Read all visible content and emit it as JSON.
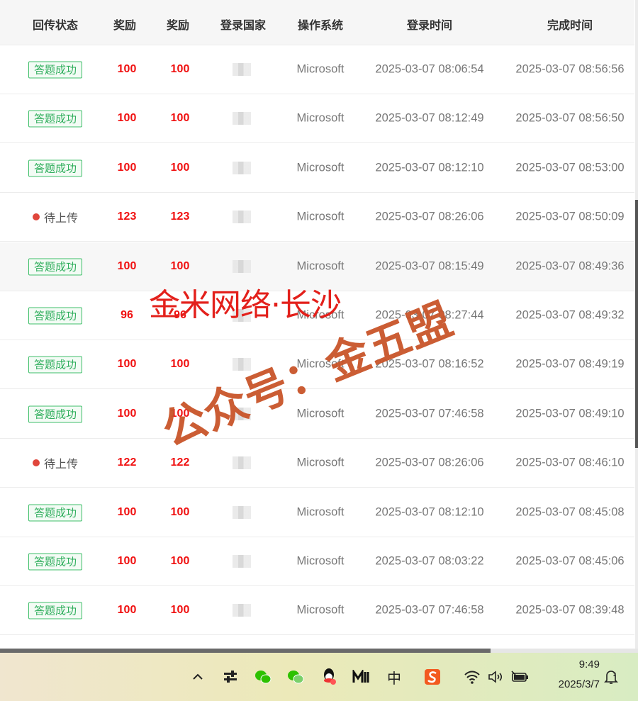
{
  "headers": [
    "回传状态",
    "奖励",
    "奖励",
    "登录国家",
    "操作系统",
    "登录时间",
    "完成时间"
  ],
  "rows": [
    {
      "status": "答题成功",
      "type": "success",
      "r1": "100",
      "r2": "100",
      "os": "Microsoft",
      "login": "2025-03-07 08:06:54",
      "done": "2025-03-07 08:56:56"
    },
    {
      "status": "答题成功",
      "type": "success",
      "r1": "100",
      "r2": "100",
      "os": "Microsoft",
      "login": "2025-03-07 08:12:49",
      "done": "2025-03-07 08:56:50"
    },
    {
      "status": "答题成功",
      "type": "success",
      "r1": "100",
      "r2": "100",
      "os": "Microsoft",
      "login": "2025-03-07 08:12:10",
      "done": "2025-03-07 08:53:00"
    },
    {
      "status": "待上传",
      "type": "pending",
      "r1": "123",
      "r2": "123",
      "os": "Microsoft",
      "login": "2025-03-07 08:26:06",
      "done": "2025-03-07 08:50:09"
    },
    {
      "status": "答题成功",
      "type": "success",
      "r1": "100",
      "r2": "100",
      "os": "Microsoft",
      "login": "2025-03-07 08:15:49",
      "done": "2025-03-07 08:49:36"
    },
    {
      "status": "答题成功",
      "type": "success",
      "r1": "96",
      "r2": "96",
      "os": "Microsoft",
      "login": "2025-03-07 08:27:44",
      "done": "2025-03-07 08:49:32"
    },
    {
      "status": "答题成功",
      "type": "success",
      "r1": "100",
      "r2": "100",
      "os": "Microsoft",
      "login": "2025-03-07 08:16:52",
      "done": "2025-03-07 08:49:19"
    },
    {
      "status": "答题成功",
      "type": "success",
      "r1": "100",
      "r2": "100",
      "os": "Microsoft",
      "login": "2025-03-07 07:46:58",
      "done": "2025-03-07 08:49:10"
    },
    {
      "status": "待上传",
      "type": "pending",
      "r1": "122",
      "r2": "122",
      "os": "Microsoft",
      "login": "2025-03-07 08:26:06",
      "done": "2025-03-07 08:46:10"
    },
    {
      "status": "答题成功",
      "type": "success",
      "r1": "100",
      "r2": "100",
      "os": "Microsoft",
      "login": "2025-03-07 08:12:10",
      "done": "2025-03-07 08:45:08"
    },
    {
      "status": "答题成功",
      "type": "success",
      "r1": "100",
      "r2": "100",
      "os": "Microsoft",
      "login": "2025-03-07 08:03:22",
      "done": "2025-03-07 08:45:06"
    },
    {
      "status": "答题成功",
      "type": "success",
      "r1": "100",
      "r2": "100",
      "os": "Microsoft",
      "login": "2025-03-07 07:46:58",
      "done": "2025-03-07 08:39:48"
    }
  ],
  "watermarks": {
    "line1": "金米网络·长沙",
    "line2": "公众号：金五盟"
  },
  "taskbar": {
    "icons": [
      "chevron-up-icon",
      "sliders-icon",
      "wechat-icon",
      "wechat-work-icon",
      "qq-icon",
      "m-app-icon",
      "ime-icon",
      "sogou-icon",
      "wifi-icon",
      "volume-icon",
      "battery-icon",
      "notification-icon"
    ],
    "ime_label": "中",
    "time": "9:49",
    "date": "2025/3/7"
  },
  "colors": {
    "success": "#2fae5c",
    "reward": "#f01010",
    "pending_dot": "#e0463c",
    "watermark_red": "#e3201b",
    "watermark_orange": "#c9552a"
  }
}
